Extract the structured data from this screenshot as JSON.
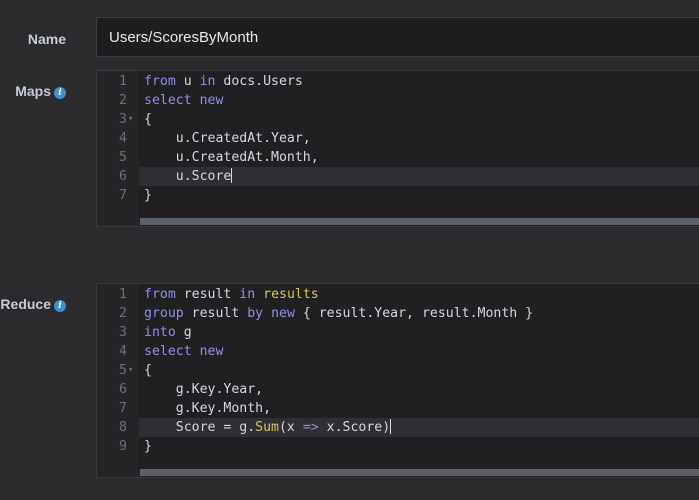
{
  "name_field": {
    "label": "Name",
    "value": "Users/ScoresByMonth"
  },
  "maps": {
    "label": "Maps",
    "info_icon": "info-icon",
    "lines": [
      {
        "n": "1",
        "fold": "",
        "tokens": [
          {
            "t": "from",
            "k": "kw"
          },
          {
            "t": " u ",
            "k": ""
          },
          {
            "t": "in",
            "k": "kw"
          },
          {
            "t": " docs.Users",
            "k": ""
          }
        ]
      },
      {
        "n": "2",
        "fold": "",
        "tokens": [
          {
            "t": "select",
            "k": "kw"
          },
          {
            "t": " ",
            "k": ""
          },
          {
            "t": "new",
            "k": "kw"
          }
        ]
      },
      {
        "n": "3",
        "fold": "▾",
        "tokens": [
          {
            "t": "{",
            "k": ""
          }
        ]
      },
      {
        "n": "4",
        "fold": "",
        "tokens": [
          {
            "t": "    u.CreatedAt.Year,",
            "k": ""
          }
        ]
      },
      {
        "n": "5",
        "fold": "",
        "tokens": [
          {
            "t": "    u.CreatedAt.Month,",
            "k": ""
          }
        ]
      },
      {
        "n": "6",
        "fold": "",
        "active": true,
        "cursor": true,
        "tokens": [
          {
            "t": "    u.Score",
            "k": ""
          }
        ]
      },
      {
        "n": "7",
        "fold": "",
        "tokens": [
          {
            "t": "}",
            "k": ""
          }
        ]
      }
    ]
  },
  "reduce": {
    "label": "Reduce",
    "info_icon": "info-icon",
    "lines": [
      {
        "n": "1",
        "fold": "",
        "tokens": [
          {
            "t": "from",
            "k": "kw"
          },
          {
            "t": " result ",
            "k": ""
          },
          {
            "t": "in",
            "k": "kw"
          },
          {
            "t": " ",
            "k": ""
          },
          {
            "t": "results",
            "k": "fn"
          }
        ]
      },
      {
        "n": "2",
        "fold": "",
        "tokens": [
          {
            "t": "group",
            "k": "kw"
          },
          {
            "t": " result ",
            "k": ""
          },
          {
            "t": "by",
            "k": "kw"
          },
          {
            "t": " ",
            "k": ""
          },
          {
            "t": "new",
            "k": "kw"
          },
          {
            "t": " { result.Year, result.Month }",
            "k": ""
          }
        ]
      },
      {
        "n": "3",
        "fold": "",
        "tokens": [
          {
            "t": "into",
            "k": "kw"
          },
          {
            "t": " g",
            "k": ""
          }
        ]
      },
      {
        "n": "4",
        "fold": "",
        "tokens": [
          {
            "t": "select",
            "k": "kw"
          },
          {
            "t": " ",
            "k": ""
          },
          {
            "t": "new",
            "k": "kw"
          }
        ]
      },
      {
        "n": "5",
        "fold": "▾",
        "tokens": [
          {
            "t": "{",
            "k": ""
          }
        ]
      },
      {
        "n": "6",
        "fold": "",
        "tokens": [
          {
            "t": "    g.Key.Year,",
            "k": ""
          }
        ]
      },
      {
        "n": "7",
        "fold": "",
        "tokens": [
          {
            "t": "    g.Key.Month,",
            "k": ""
          }
        ]
      },
      {
        "n": "8",
        "fold": "",
        "active": true,
        "cursor": true,
        "tokens": [
          {
            "t": "    Score = g.",
            "k": ""
          },
          {
            "t": "Sum",
            "k": "fn"
          },
          {
            "t": "(x ",
            "k": ""
          },
          {
            "t": "=>",
            "k": "kw"
          },
          {
            "t": " x.Score)",
            "k": ""
          }
        ]
      },
      {
        "n": "9",
        "fold": "",
        "tokens": [
          {
            "t": "}",
            "k": ""
          }
        ]
      }
    ]
  },
  "colors": {
    "background": "#2b2b2e",
    "keyword": "#8e8fe6",
    "function": "#d8c45a",
    "info": "#3a8fd9"
  }
}
